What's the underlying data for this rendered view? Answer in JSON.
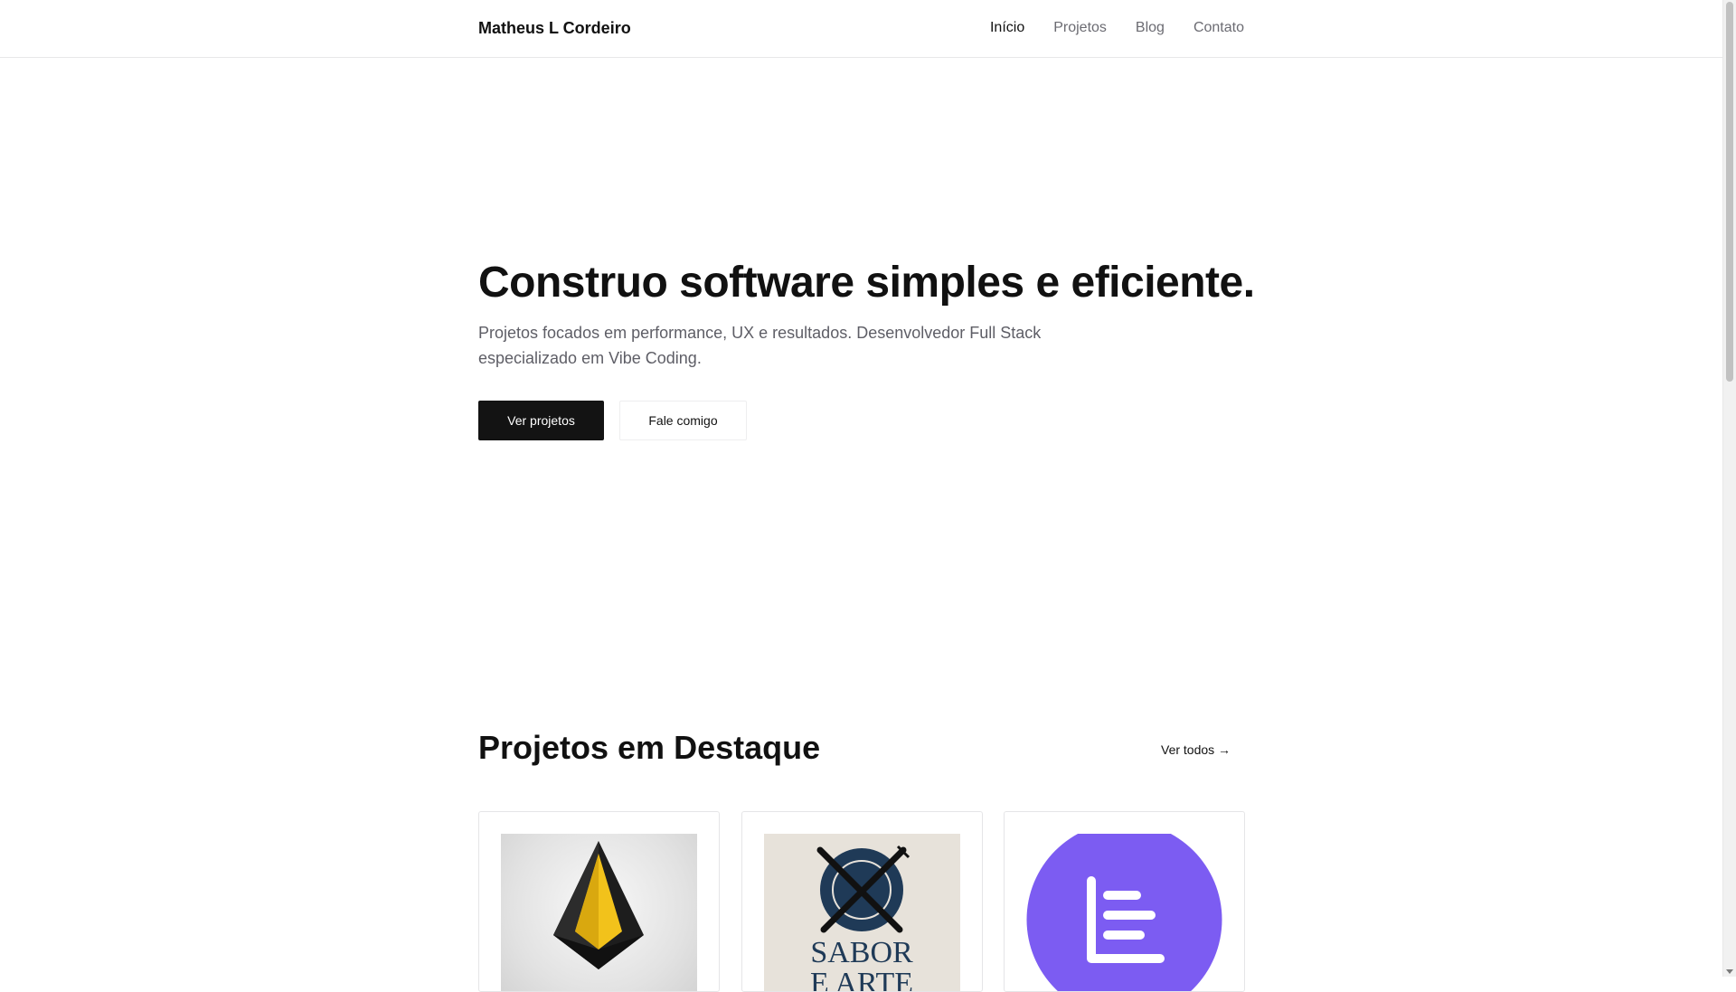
{
  "header": {
    "brand": "Matheus L Cordeiro",
    "nav": [
      {
        "label": "Início",
        "active": true
      },
      {
        "label": "Projetos",
        "active": false
      },
      {
        "label": "Blog",
        "active": false
      },
      {
        "label": "Contato",
        "active": false
      }
    ]
  },
  "hero": {
    "title": "Construo software simples e eficiente.",
    "subtitle": "Projetos focados em performance, UX e resultados. Desenvolvedor Full Stack especializado em Vibe Coding.",
    "primary_button": "Ver projetos",
    "secondary_button": "Fale comigo"
  },
  "projects": {
    "title": "Projetos em Destaque",
    "see_all": "Ver todos →",
    "cards": [
      {
        "image": "gold-diamond-logo",
        "color": "#f2c21b"
      },
      {
        "image": "sabor-e-arte-logo",
        "lettering": "SABOR E ARTE",
        "color": "#1f3a57"
      },
      {
        "image": "chart-logo",
        "color": "#7c5cf2"
      }
    ]
  },
  "colors": {
    "primary_button": "#131313",
    "text": "#111111",
    "muted_text": "#5e5e66",
    "border": "#e5e5e7"
  }
}
